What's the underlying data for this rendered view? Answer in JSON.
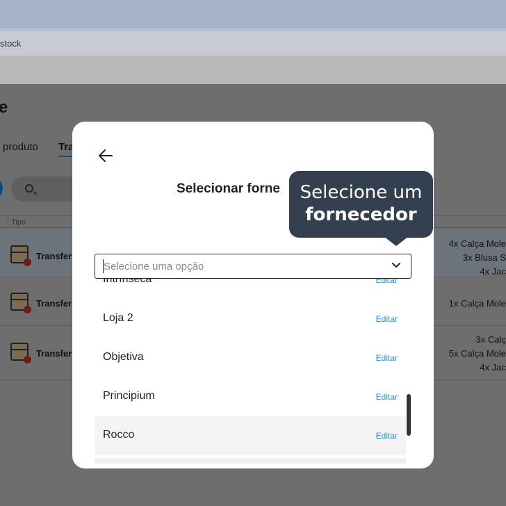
{
  "browser": {
    "url_fragment": "stock"
  },
  "page": {
    "title_fragment": "e",
    "tabs": [
      "produto",
      "Tra"
    ],
    "table_header": "Tipo",
    "rows": [
      {
        "type": "Transfer",
        "items": [
          "4x Calça Mole",
          "3x Blusa S",
          "4x Jac"
        ]
      },
      {
        "type": "Transfer",
        "items": [
          "1x Calça Mole"
        ]
      },
      {
        "type": "Transfer",
        "items": [
          "3x Calç",
          "5x Calça Mole",
          "4x Jac"
        ]
      }
    ]
  },
  "modal": {
    "title": "Selecionar forne",
    "select": {
      "placeholder": "Selecione uma opção"
    },
    "options": [
      {
        "label": "Intrínseca",
        "edit": "Editar"
      },
      {
        "label": "Loja 2",
        "edit": "Editar"
      },
      {
        "label": "Objetiva",
        "edit": "Editar"
      },
      {
        "label": "Principium",
        "edit": "Editar"
      },
      {
        "label": "Rocco",
        "edit": "Editar"
      }
    ]
  },
  "tooltip": {
    "line1": "Selecione um",
    "line2": "fornecedor"
  },
  "colors": {
    "accent_link": "#2e8fd6",
    "tooltip_bg": "#34404f"
  }
}
